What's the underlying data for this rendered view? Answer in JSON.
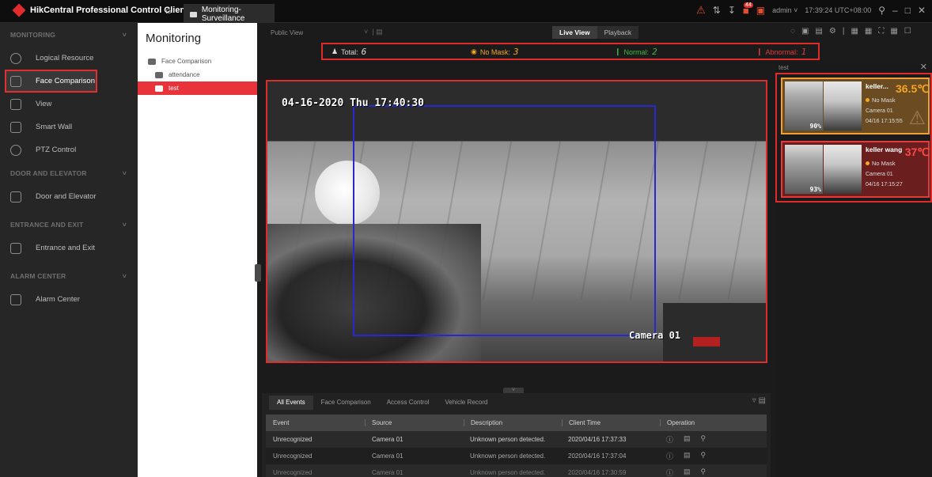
{
  "titlebar": {
    "app_title": "HikCentral Professional Control Client",
    "active_tab": "Monitoring-Surveillance",
    "alarm_count": "44",
    "user": "admin ˅",
    "clock": "17:39:24 UTC+08:00",
    "icons": [
      "alarm-icon",
      "arrows-icon",
      "download-icon",
      "camera-icon",
      "lock-icon"
    ]
  },
  "leftnav": {
    "sections": [
      {
        "header": "MONITORING",
        "items": [
          {
            "label": "Logical Resource",
            "icon": "globe-icon"
          },
          {
            "label": "Face Comparison",
            "icon": "face-icon",
            "active": true
          },
          {
            "label": "View",
            "icon": "view-icon"
          },
          {
            "label": "Smart Wall",
            "icon": "wall-icon"
          },
          {
            "label": "PTZ Control",
            "icon": "ptz-icon"
          }
        ]
      },
      {
        "header": "DOOR AND ELEVATOR",
        "items": [
          {
            "label": "Door and Elevator",
            "icon": "door-icon"
          }
        ]
      },
      {
        "header": "ENTRANCE AND EXIT",
        "items": [
          {
            "label": "Entrance and Exit",
            "icon": "barrier-icon"
          }
        ]
      },
      {
        "header": "ALARM CENTER",
        "items": [
          {
            "label": "Alarm Center",
            "icon": "alarm-icon"
          }
        ]
      }
    ]
  },
  "resource": {
    "title": "Monitoring",
    "tree": [
      {
        "label": "Face Comparison",
        "level": 0
      },
      {
        "label": "attendance",
        "level": 1
      },
      {
        "label": "test",
        "level": 1,
        "selected": true
      }
    ]
  },
  "toolbar": {
    "public_view": "Public View",
    "live_view": "Live View",
    "playback": "Playback"
  },
  "stats": {
    "total_label": "Total:",
    "total_value": "6",
    "mask_label": "No Mask:",
    "mask_value": "3",
    "normal_label": "Normal:",
    "normal_value": "2",
    "abnormal_label": "Abnormal:",
    "abnormal_value": "1"
  },
  "video": {
    "timestamp": "04-16-2020 Thu 17:40:30",
    "camera_label": "Camera 01"
  },
  "events": {
    "tabs": [
      "All Events",
      "Face Comparison",
      "Access Control",
      "Vehicle Record"
    ],
    "columns": [
      "Event",
      "Source",
      "Description",
      "Client Time",
      "Operation"
    ],
    "rows": [
      {
        "event": "Unrecognized",
        "source": "Camera 01",
        "description": "Unknown person detected.",
        "time": "2020/04/16 17:37:33"
      },
      {
        "event": "Unrecognized",
        "source": "Camera 01",
        "description": "Unknown person detected.",
        "time": "2020/04/16 17:37:04"
      },
      {
        "event": "Unrecognized",
        "source": "Camera 01",
        "description": "Unknown person detected.",
        "time": "2020/04/16 17:30:59"
      }
    ]
  },
  "rightpanel": {
    "title": "test",
    "cards": [
      {
        "name": "keller...",
        "temp": "36.5℃",
        "mask": "No Mask",
        "camera": "Camera 01",
        "time": "04/16 17:15:55",
        "similarity": "90%"
      },
      {
        "name": "keller wang",
        "temp": "37℃",
        "mask": "No Mask",
        "camera": "Camera 01",
        "time": "04/16 17:15:27",
        "similarity": "93%"
      }
    ]
  },
  "colors": {
    "accent_red": "#e02b2b",
    "warning_orange": "#f5a623",
    "normal_green": "#3fb83f",
    "detect_box_blue": "#2828d0"
  }
}
